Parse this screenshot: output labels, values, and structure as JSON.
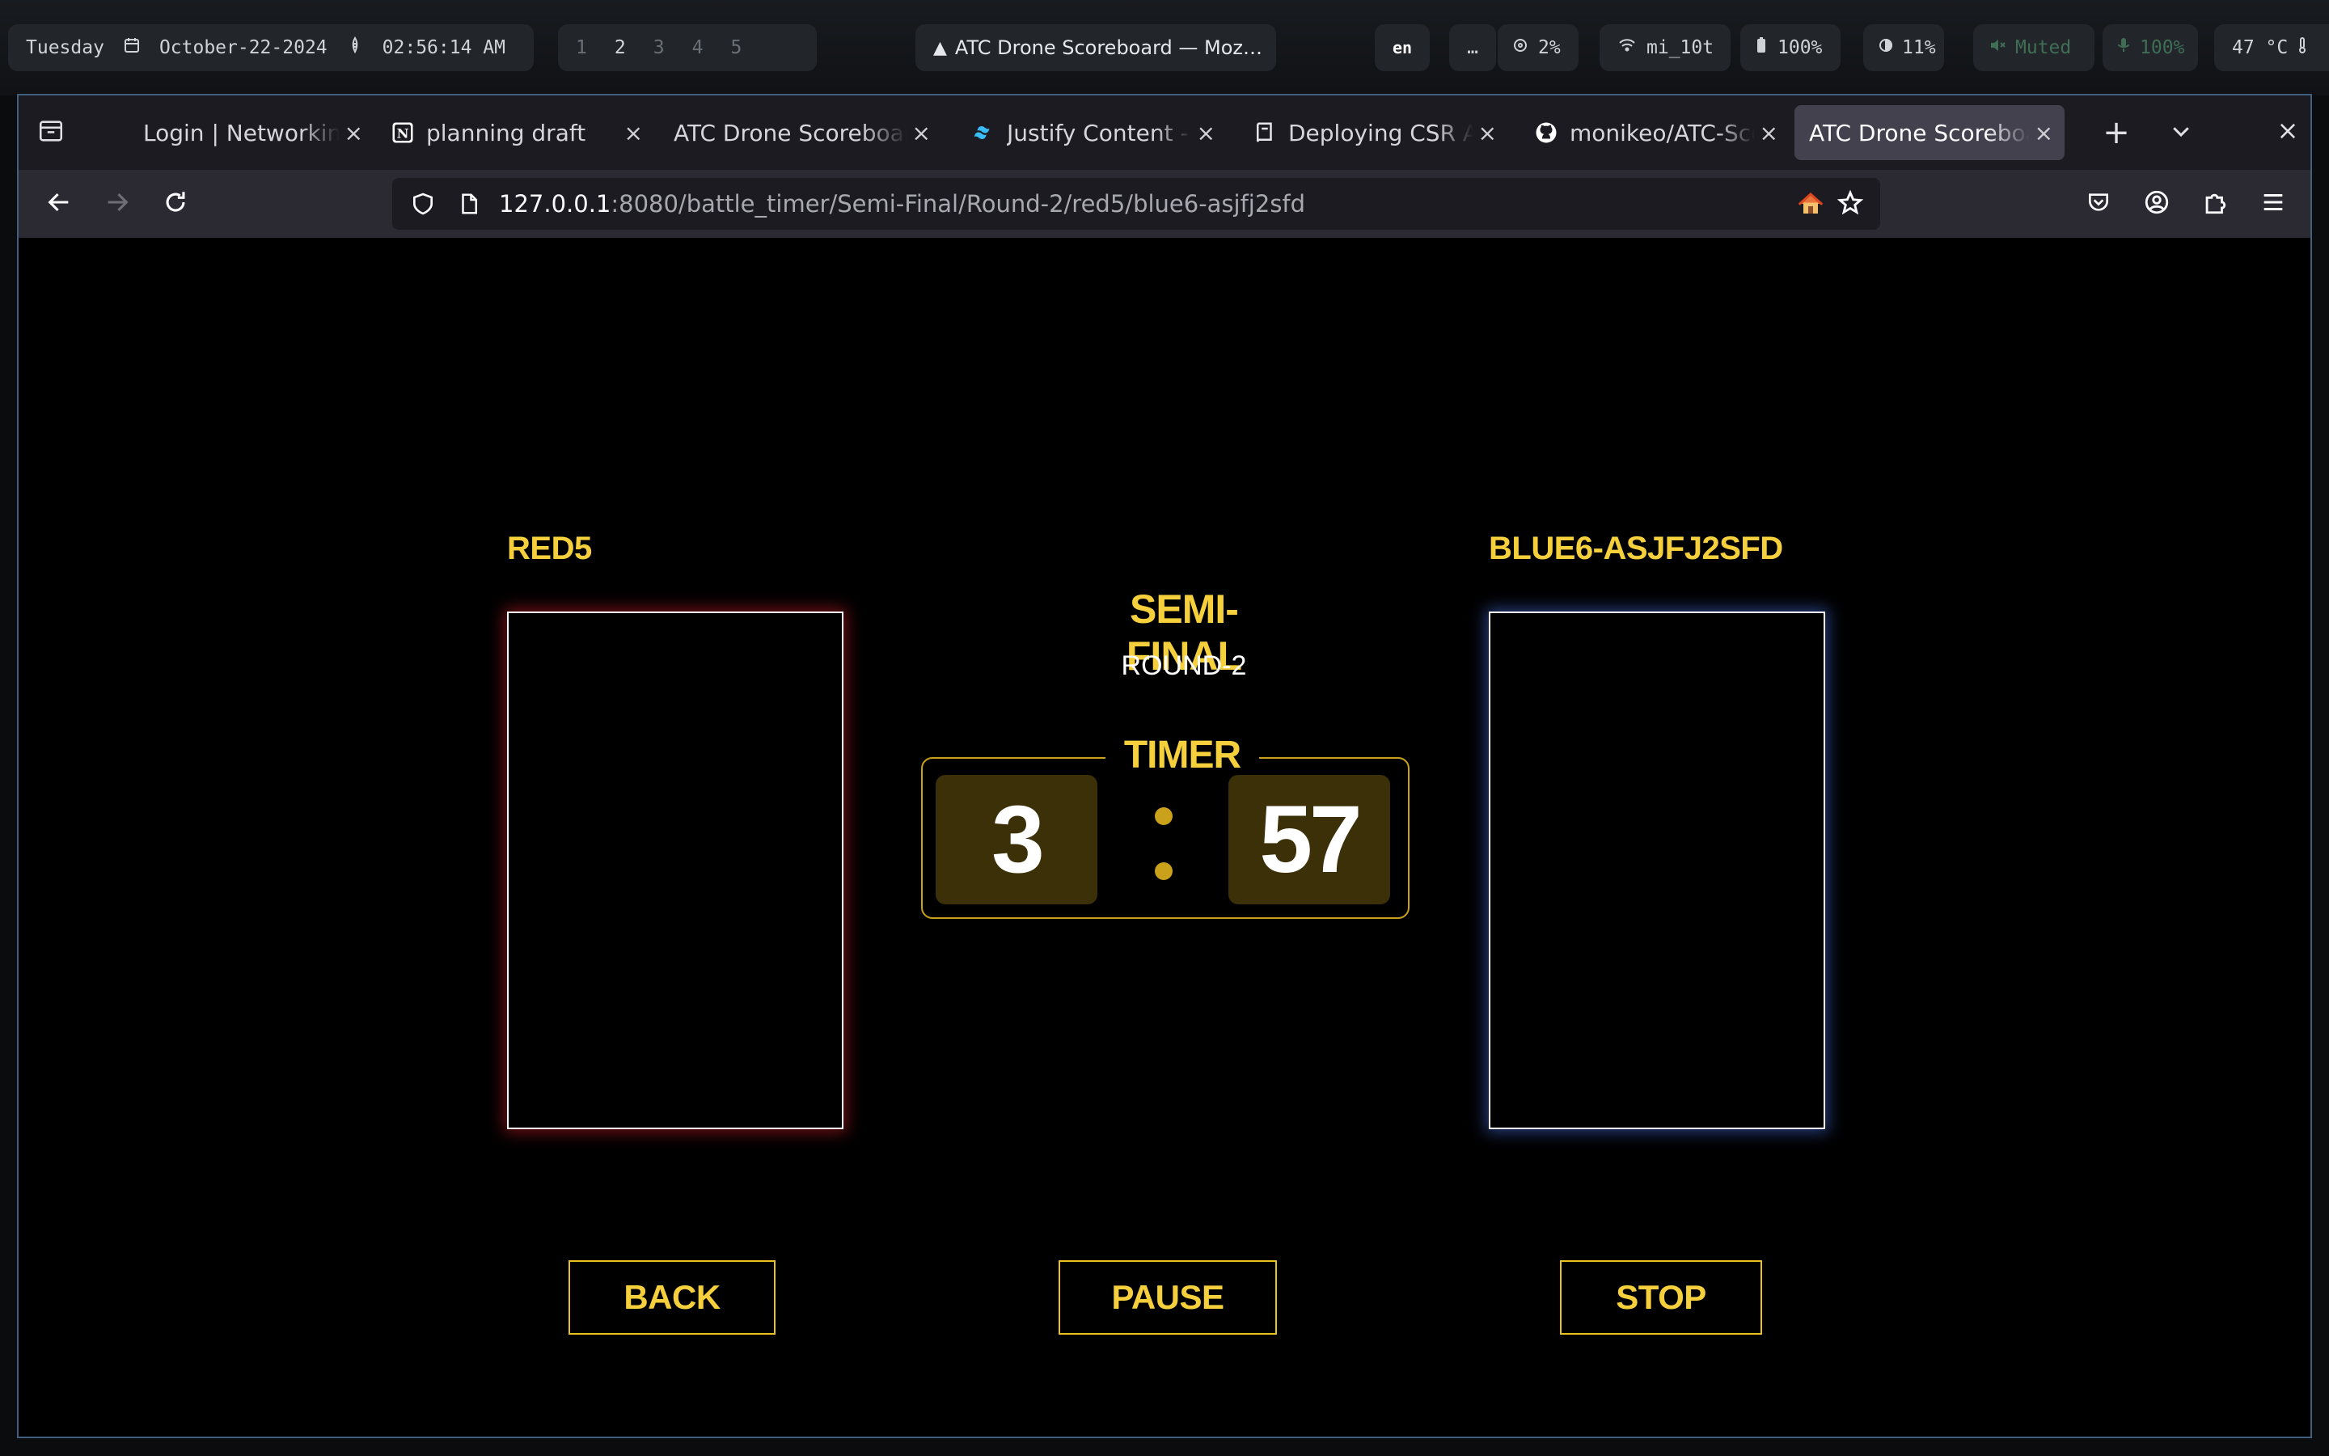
{
  "system_bar": {
    "day": "Tuesday",
    "date": "October-22-2024",
    "time": "02:56:14 AM",
    "workspaces": [
      "1",
      "2",
      "3",
      "4",
      "5"
    ],
    "active_workspace": "2",
    "window_title": "ATC Drone Scoreboard — Moz…",
    "language": "en",
    "overflow": "…",
    "cpu": "2%",
    "wifi": "mi_10t",
    "battery": "100%",
    "brightness": "11%",
    "volume": "Muted",
    "mic": "100%",
    "temperature": "47 °C"
  },
  "browser": {
    "tabs": [
      {
        "label": "Login | Networking",
        "icon": "none-icon"
      },
      {
        "label": "planning draft",
        "icon": "notion-icon"
      },
      {
        "label": "ATC Drone Scoreboard",
        "icon": "none-icon"
      },
      {
        "label": "Justify Content - Tailwind",
        "icon": "tailwind-icon"
      },
      {
        "label": "Deploying CSR Apps",
        "icon": "book-icon"
      },
      {
        "label": "monikeo/ATC-Scoreboard",
        "icon": "github-icon"
      },
      {
        "label": "ATC Drone Scoreboard",
        "icon": "none-icon",
        "active": true
      }
    ],
    "url_host": "127.0.0.1",
    "url_path": ":8080/battle_timer/Semi-Final/Round-2/red5/blue6-asjfj2sfd"
  },
  "battle": {
    "red_pilot": "RED5",
    "blue_pilot": "BLUE6-ASJFJ2SFD",
    "stage": "SEMI-FINAL",
    "round": "ROUND-2",
    "timer_label": "TIMER",
    "minutes": "3",
    "seconds": "57",
    "back_label": "BACK",
    "pause_label": "PAUSE",
    "stop_label": "STOP"
  },
  "colors": {
    "accent_yellow": "#f5d03c",
    "red_glow": "#c81e28",
    "blue_glow": "#466edc"
  }
}
